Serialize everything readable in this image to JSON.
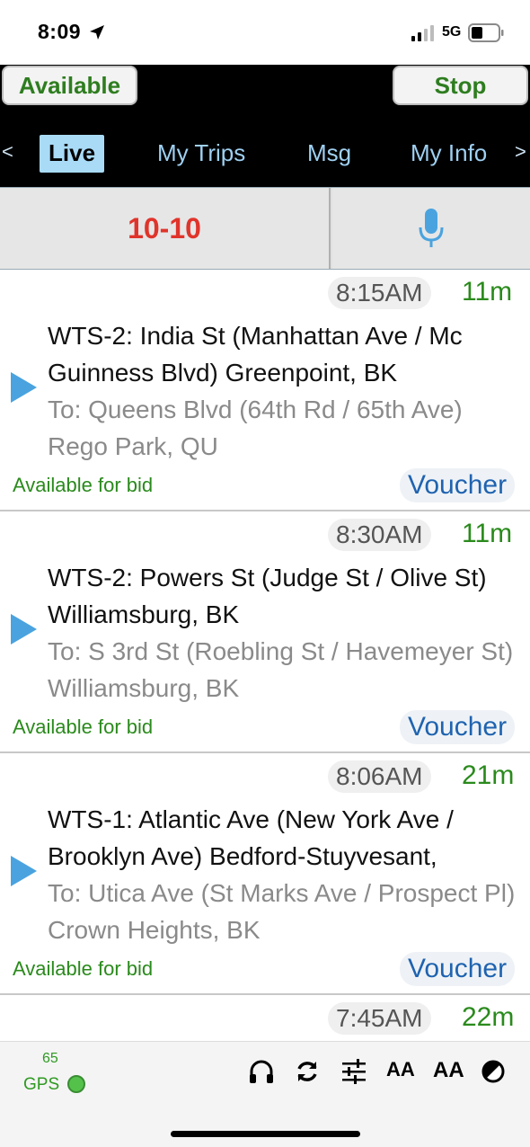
{
  "status_bar": {
    "time": "8:09",
    "network": "5G"
  },
  "top_bar": {
    "available_label": "Available",
    "stop_label": "Stop"
  },
  "nav": {
    "prev": "<",
    "next": ">",
    "tabs": [
      {
        "label": "Live",
        "active": true
      },
      {
        "label": "My Trips",
        "active": false
      },
      {
        "label": "Msg",
        "active": false
      },
      {
        "label": "My Info",
        "active": false
      }
    ]
  },
  "actions": {
    "code_label": "10-10"
  },
  "trips": [
    {
      "time": "8:15AM",
      "eta": "11m",
      "from": "WTS-2: India St (Manhattan Ave / Mc Guinness Blvd) Greenpoint, BK",
      "to": "To: Queens Blvd (64th Rd / 65th Ave) Rego Park, QU",
      "status": "Available for bid",
      "voucher": "Voucher"
    },
    {
      "time": "8:30AM",
      "eta": "11m",
      "from": "WTS-2: Powers St (Judge St / Olive St) Williamsburg, BK",
      "to": "To: S 3rd St (Roebling St / Havemeyer St) Williamsburg, BK",
      "status": "Available for bid",
      "voucher": "Voucher"
    },
    {
      "time": "8:06AM",
      "eta": "21m",
      "from": "WTS-1: Atlantic Ave (New York Ave / Brooklyn Ave) Bedford-Stuyvesant,",
      "to": "To: Utica Ave (St Marks Ave / Prospect Pl) Crown Heights, BK",
      "status": "Available for bid",
      "voucher": "Voucher"
    },
    {
      "time": "7:45AM",
      "eta": "22m"
    }
  ],
  "bottom_bar": {
    "gps_count": "65",
    "gps_label": "GPS",
    "text_small_label": "AA",
    "text_large_label": "AA"
  },
  "colors": {
    "accent_green": "#2a8a1c",
    "link_blue": "#1f63b0",
    "alert_red": "#e0342b",
    "tab_active_bg": "#a9dbf7"
  }
}
